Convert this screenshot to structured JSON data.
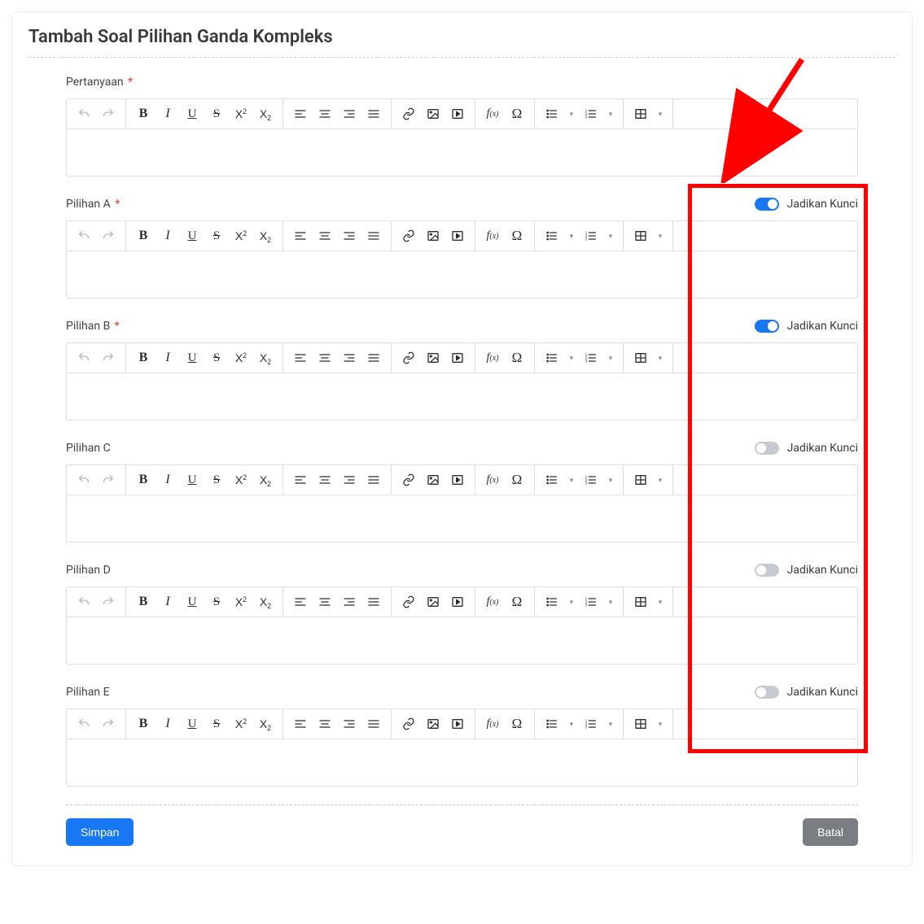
{
  "title": "Tambah Soal Pilihan Ganda Kompleks",
  "question": {
    "label": "Pertanyaan",
    "required": true
  },
  "key_toggle_label": "Jadikan Kunci",
  "options": [
    {
      "label": "Pilihan A",
      "required": true,
      "is_key": true
    },
    {
      "label": "Pilihan B",
      "required": true,
      "is_key": true
    },
    {
      "label": "Pilihan C",
      "required": false,
      "is_key": false
    },
    {
      "label": "Pilihan D",
      "required": false,
      "is_key": false
    },
    {
      "label": "Pilihan E",
      "required": false,
      "is_key": false
    }
  ],
  "buttons": {
    "save": "Simpan",
    "cancel": "Batal"
  },
  "toolbar_icons": {
    "undo": "undo-icon",
    "redo": "redo-icon",
    "bold": "bold-icon",
    "italic": "italic-icon",
    "underline": "underline-icon",
    "strike": "strikethrough-icon",
    "sup": "superscript-icon",
    "sub": "subscript-icon",
    "align_left": "align-left-icon",
    "align_center": "align-center-icon",
    "align_right": "align-right-icon",
    "align_justify": "align-justify-icon",
    "link": "link-icon",
    "image": "image-icon",
    "video": "video-icon",
    "math": "math-icon",
    "omega": "symbol-icon",
    "ul": "unordered-list-icon",
    "ol": "ordered-list-icon",
    "table": "table-icon"
  }
}
